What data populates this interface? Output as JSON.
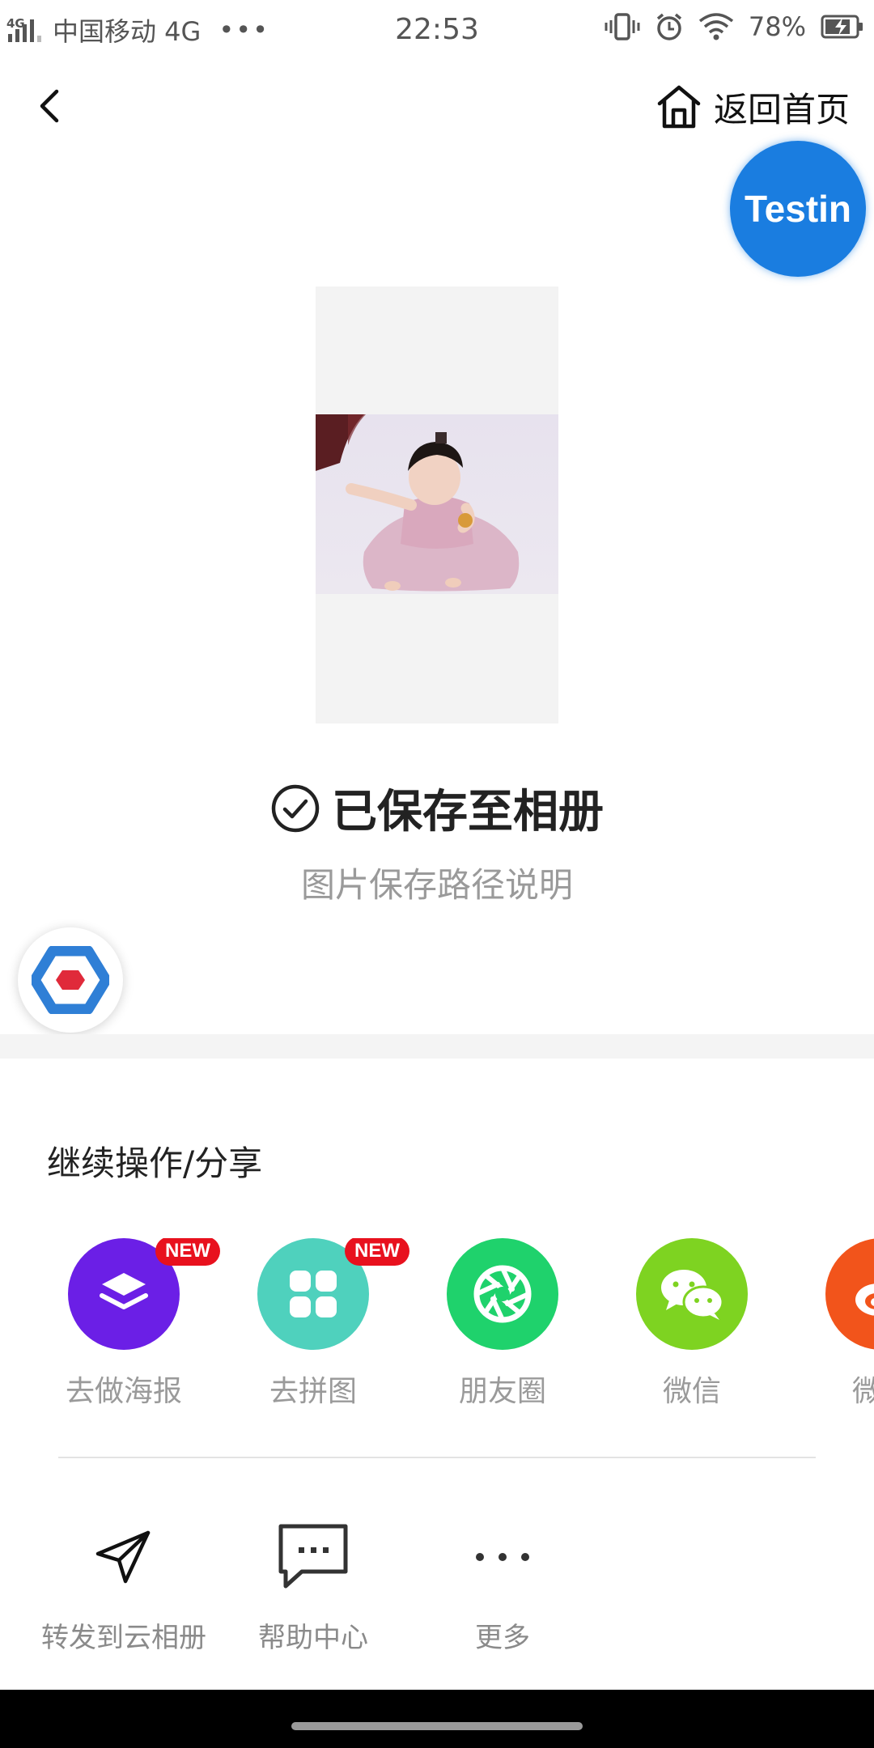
{
  "status_bar": {
    "network_tag": "4G",
    "carrier": "中国移动 4G",
    "more": "•••",
    "time": "22:53",
    "battery": "78%"
  },
  "nav": {
    "home_label": "返回首页"
  },
  "overlay": {
    "testin_label": "Testin"
  },
  "result": {
    "title": "已保存至相册",
    "subtitle": "图片保存路径说明"
  },
  "share_section": {
    "title": "继续操作/分享",
    "new_badge": "NEW",
    "items": [
      {
        "label": "去做海报",
        "icon": "layers-icon",
        "color": "#6b1fe6",
        "is_new": true
      },
      {
        "label": "去拼图",
        "icon": "grid-icon",
        "color": "#4fd1bd",
        "is_new": true
      },
      {
        "label": "朋友圈",
        "icon": "aperture-icon",
        "color": "#1fd26c",
        "is_new": false
      },
      {
        "label": "微信",
        "icon": "wechat-icon",
        "color": "#7ed321",
        "is_new": false
      },
      {
        "label": "微博",
        "icon": "weibo-icon",
        "color": "#f2541b",
        "is_new": false
      }
    ]
  },
  "tools": [
    {
      "label": "转发到云相册",
      "icon": "paper-plane-icon"
    },
    {
      "label": "帮助中心",
      "icon": "chat-bubble-icon"
    },
    {
      "label": "更多",
      "icon": "more-dots-icon"
    }
  ],
  "colors": {
    "accent_blue": "#1a7de0",
    "badge_red": "#e8111e",
    "subtle_text": "#9a9a9a"
  }
}
